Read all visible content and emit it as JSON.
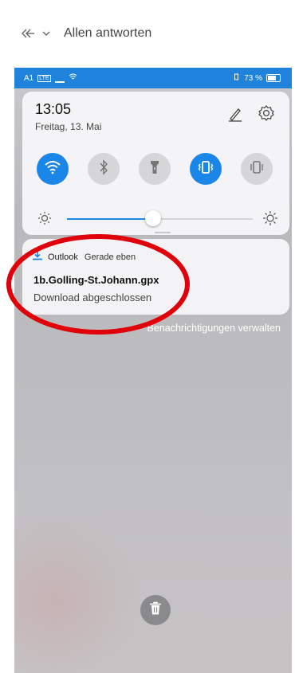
{
  "mail_toolbar": {
    "reply_icon": "reply-all-icon",
    "dropdown_icon": "chevron-down-icon",
    "label": "Allen antworten"
  },
  "status_bar": {
    "carrier": "A1",
    "network": "LTE",
    "battery": "73 %"
  },
  "quick_settings": {
    "time": "13:05",
    "date": "Freitag, 13. Mai",
    "toggles": [
      {
        "name": "wifi",
        "icon": "wifi-icon",
        "on": true
      },
      {
        "name": "bluetooth",
        "icon": "bluetooth-icon",
        "on": false
      },
      {
        "name": "flashlight",
        "icon": "flashlight-icon",
        "on": false
      },
      {
        "name": "vibrate",
        "icon": "vibrate-icon",
        "on": true
      },
      {
        "name": "silent",
        "icon": "phone-mode-icon",
        "on": false
      }
    ],
    "brightness": 0.36
  },
  "notification": {
    "app": "Outlook",
    "time": "Gerade eben",
    "title": "1b.Golling-St.Johann.gpx",
    "body": "Download abgeschlossen"
  },
  "manage_label": "Benachrichtigungen verwalten",
  "colors": {
    "accent": "#1a86e8",
    "annotation": "#e0000a"
  }
}
